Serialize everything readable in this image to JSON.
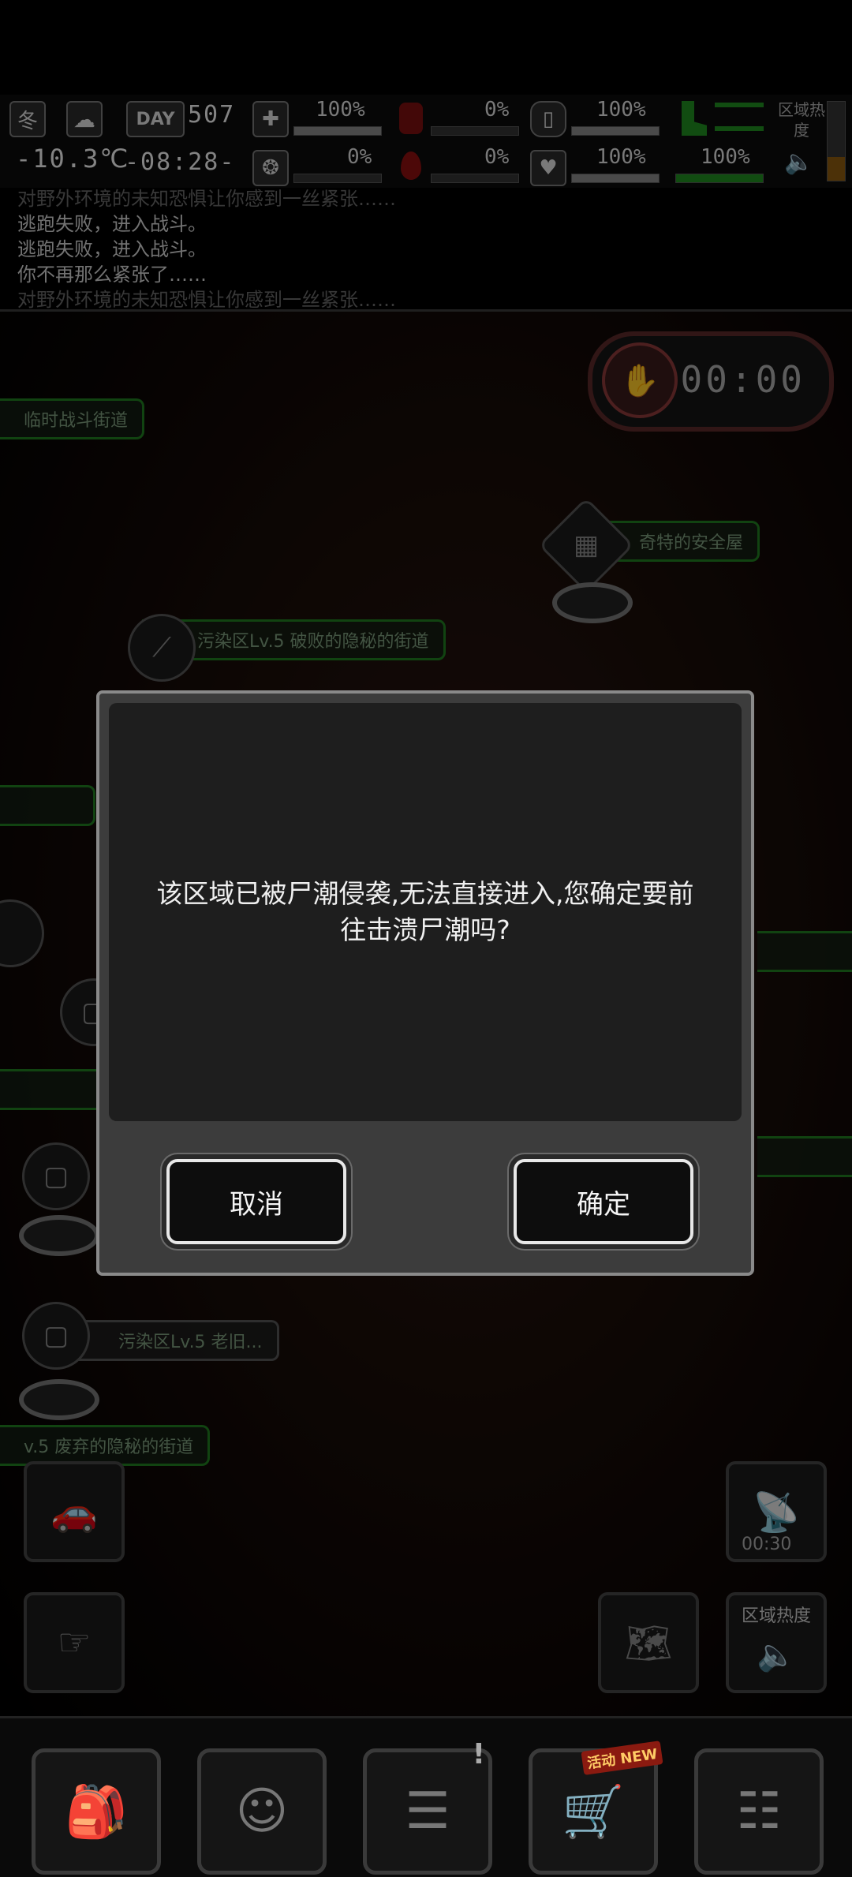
{
  "hud": {
    "season": "冬",
    "temperature": "-10.3℃",
    "day_label": "DAY",
    "day_number": "507",
    "clock": "-08:28-",
    "stats": [
      {
        "icon": "medkit-icon",
        "value": "100%",
        "level": 1.0
      },
      {
        "icon": "stomach-icon",
        "value": "0%",
        "level": 0.0
      },
      {
        "icon": "water-bottle-icon",
        "value": "100%",
        "level": 1.0
      },
      {
        "icon": "brain-icon",
        "value": "0%",
        "level": 0.0
      },
      {
        "icon": "blood-drop-icon",
        "value": "0%",
        "level": 0.0
      },
      {
        "icon": "heart-icon",
        "value": "100%",
        "level": 1.0
      },
      {
        "icon": "boot-icon",
        "value": "100%",
        "level": 1.0
      }
    ],
    "area_heat_label": "区域热度"
  },
  "log": {
    "lines": [
      "对野外环境的未知恐惧让你感到一丝紧张……",
      "逃跑失败，进入战斗。",
      "逃跑失败，进入战斗。",
      "你不再那么紧张了……",
      "对野外环境的未知恐惧让你感到一丝紧张……"
    ]
  },
  "map": {
    "timer": "00:00",
    "locations": [
      {
        "label": "临时战斗街道"
      },
      {
        "label": "奇特的安全屋"
      },
      {
        "label": "污染区Lv.5 破败的隐秘的街道"
      },
      {
        "label": "污染区Lv.5 老旧..."
      },
      {
        "label": "v.5 废弃的隐秘的街道"
      }
    ],
    "radar_timer": "00:30",
    "area_heat_button": "区域热度"
  },
  "dialog": {
    "message": "该区域已被尸潮侵袭,无法直接进入,您确定要前往击溃尸潮吗?",
    "cancel_label": "取消",
    "confirm_label": "确定"
  },
  "bottom_nav": {
    "items": [
      {
        "icon": "backpack-icon"
      },
      {
        "icon": "head-brain-icon"
      },
      {
        "icon": "notebook-icon"
      },
      {
        "icon": "shopping-cart-icon",
        "badge": "活动 NEW"
      },
      {
        "icon": "menu-list-icon"
      }
    ]
  }
}
